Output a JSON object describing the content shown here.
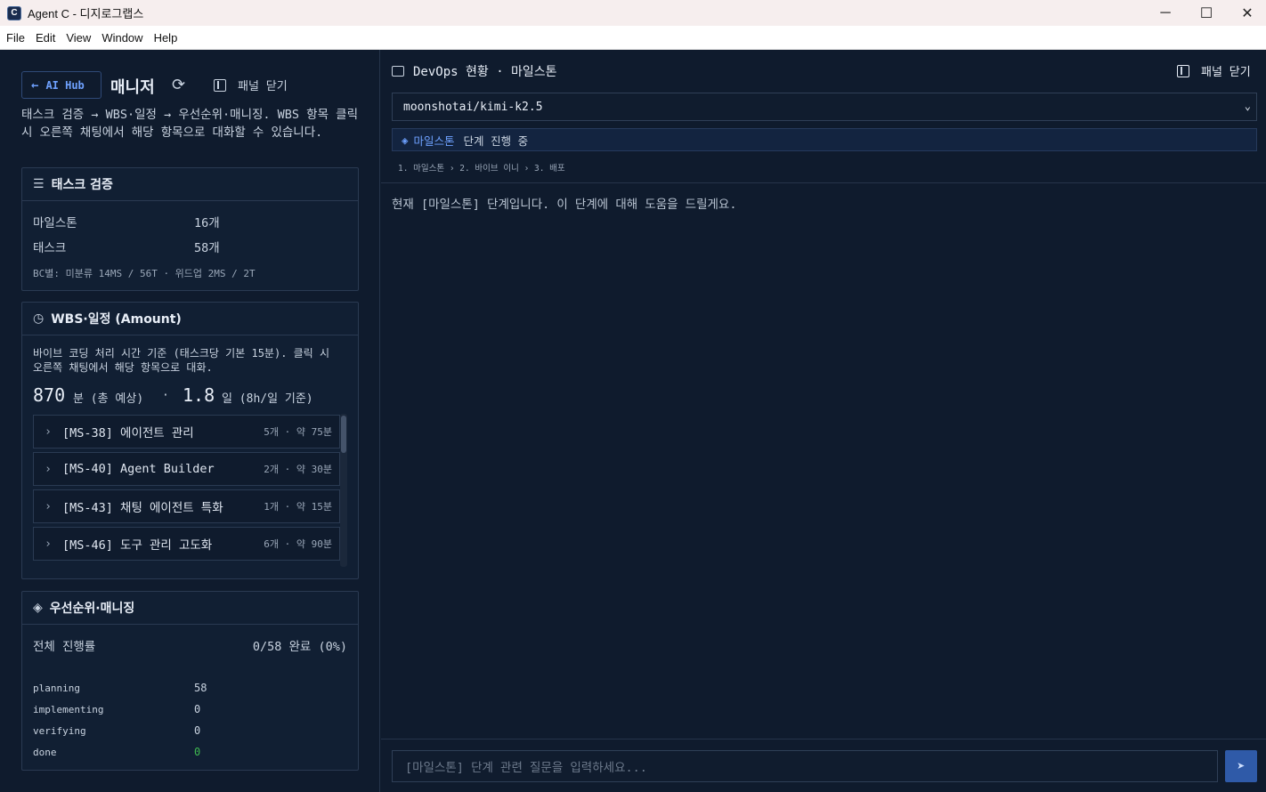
{
  "window": {
    "title": "Agent C - 디지로그랩스",
    "app_icon_letter": "C",
    "controls": {
      "minimize": "─",
      "maximize": "☐",
      "close": "✕"
    }
  },
  "menu": [
    "File",
    "Edit",
    "View",
    "Window",
    "Help"
  ],
  "left_panel": {
    "back_label": "AI Hub",
    "title": "매니저",
    "close_panel_label": "패널 닫기",
    "description": "태스크 검증 → WBS·일정 → 우선순위·매니징. WBS 항목 클릭 시 오른쪽 채팅에서 해당 항목으로 대화할 수 있습니다.",
    "task_verify": {
      "heading": "태스크 검증",
      "rows": [
        {
          "label": "마일스톤",
          "value": "16개"
        },
        {
          "label": "태스크",
          "value": "58개"
        }
      ],
      "bc_note": "BC별: 미분류 14MS / 56T · 위드업 2MS / 2T"
    },
    "wbs": {
      "heading": "WBS·일정 (Amount)",
      "note": "바이브 코딩 처리 시간 기준 (태스크당 기본 15분). 클릭 시 오른쪽 채팅에서 해당 항목으로 대화.",
      "total_minutes": "870",
      "minutes_label": "분 (총 예상)",
      "dot": "·",
      "total_days": "1.8",
      "days_label": "일 (8h/일 기준)",
      "items": [
        {
          "label": "[MS-38] 에이전트 관리",
          "meta": "5개 · 약 75분"
        },
        {
          "label": "[MS-40] Agent Builder",
          "meta": "2개 · 약 30분"
        },
        {
          "label": "[MS-43] 채팅 에이전트 특화",
          "meta": "1개 · 약 15분"
        },
        {
          "label": "[MS-46] 도구 관리 고도화",
          "meta": "6개 · 약 90분"
        }
      ]
    },
    "priority": {
      "heading": "우선순위·매니징",
      "progress_label": "전체 진행률",
      "progress_value": "0/58 완료 (0%)",
      "statuses": [
        {
          "label": "planning",
          "value": "58",
          "color": "#c9d3e0"
        },
        {
          "label": "implementing",
          "value": "0",
          "color": "#c9d3e0"
        },
        {
          "label": "verifying",
          "value": "0",
          "color": "#c9d3e0"
        },
        {
          "label": "done",
          "value": "0",
          "color": "#3fb950"
        }
      ]
    }
  },
  "chat": {
    "header": "DevOps 현황 · 마일스톤",
    "close_panel_label": "패널 닫기",
    "model": "moonshotai/kimi-k2.5",
    "stage_name": "마일스톤",
    "stage_status": "단계 진행 중",
    "steps": "1. 마일스톤 › 2. 바이브 이니 › 3. 배포",
    "message": "현재 [마일스톤] 단계입니다. 이 단계에 대해 도움을 드릴게요.",
    "input_placeholder": "[마일스톤] 단계 관련 질문을 입력하세요...",
    "accent": "#2f5aa8"
  }
}
